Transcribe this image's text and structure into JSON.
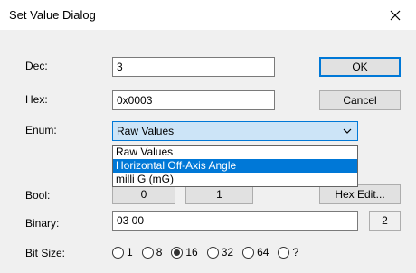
{
  "window": {
    "title": "Set Value Dialog",
    "close_glyph": "✕"
  },
  "labels": {
    "dec": "Dec:",
    "hex": "Hex:",
    "enum": "Enum:",
    "bool": "Bool:",
    "binary": "Binary:",
    "bit_size": "Bit Size:"
  },
  "fields": {
    "dec": "3",
    "hex": "0x0003",
    "binary": "03 00",
    "byte_count": "2"
  },
  "buttons": {
    "ok": "OK",
    "cancel": "Cancel",
    "bool_false": "0",
    "bool_true": "1",
    "hex_edit": "Hex Edit..."
  },
  "enum": {
    "selected": "Raw Values",
    "options": [
      "Raw Values",
      "Horizontal Off-Axis Angle",
      "milli G (mG)"
    ],
    "highlighted_index": 1
  },
  "bit_size": {
    "options": [
      "1",
      "8",
      "16",
      "32",
      "64",
      "?"
    ],
    "selected": "16"
  },
  "colors": {
    "accent": "#0078d7",
    "combo_bg": "#cce4f7"
  }
}
